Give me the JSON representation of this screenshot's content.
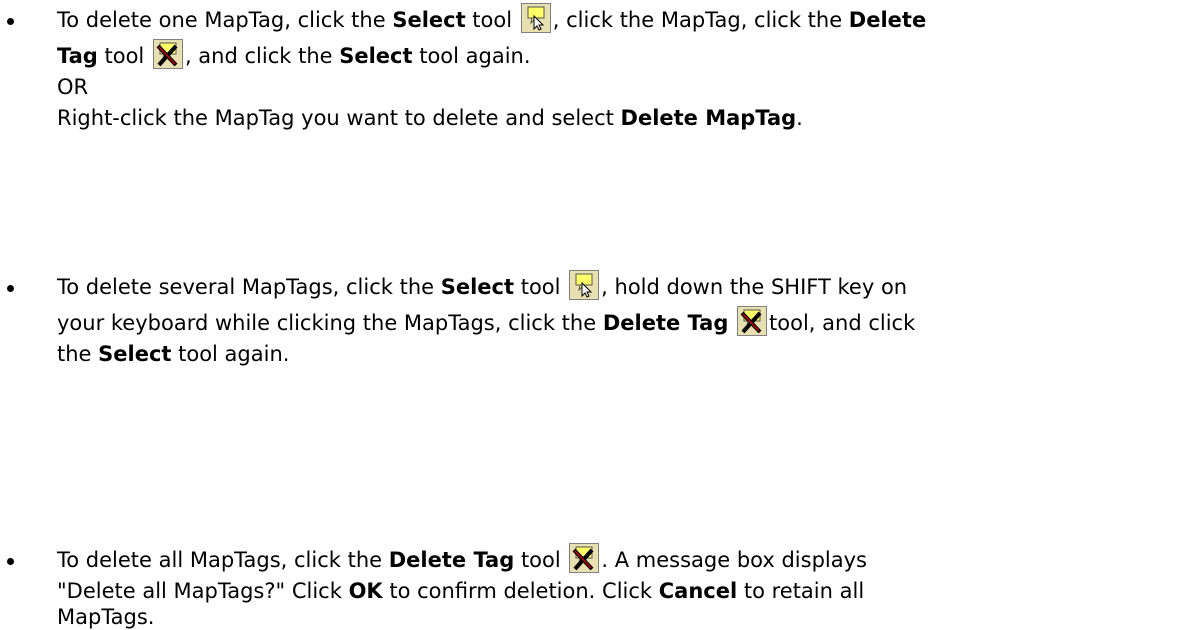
{
  "items": [
    {
      "lines": [
        [
          "To delete one MapTag, click the ",
          "Select",
          " tool ",
          "{select-icon}",
          ", click the MapTag, click the ",
          "Delete"
        ],
        [
          "Tag",
          " tool ",
          "{delete-icon}",
          ", and click the ",
          "Select",
          " tool again."
        ],
        [
          "OR"
        ],
        [
          "Right-click the MapTag you want to delete and select ",
          "Delete MapTag",
          "."
        ]
      ]
    },
    {
      "lines": [
        [
          "To delete several MapTags, click the ",
          "Select",
          " tool ",
          "{select-icon}",
          ", hold down the SHIFT key on"
        ],
        [
          "your keyboard while clicking the MapTags, click the ",
          "Delete Tag",
          " ",
          "{delete-icon}",
          "tool, and click"
        ],
        [
          "the ",
          "Select",
          " tool again."
        ]
      ]
    },
    {
      "lines": [
        [
          "To delete all MapTags, click the ",
          "Delete Tag",
          " tool ",
          "{delete-icon}",
          ". A message box displays"
        ],
        [
          "\"Delete all MapTags?\" Click ",
          "OK",
          " to confirm deletion. Click ",
          "Cancel",
          " to retain all"
        ],
        [
          "MapTags."
        ]
      ]
    }
  ],
  "text": {
    "i1l1a": "To delete one MapTag, click the ",
    "select": "Select",
    "tool_sp": " tool ",
    "i1l1b": ", click the MapTag, click the ",
    "delete": "Delete",
    "tag": "Tag",
    "i1l2a": ", and click the ",
    "tool_again": " tool again.",
    "or": "OR",
    "i1l4a": "Right-click the MapTag you want to delete and select ",
    "delete_maptag": "Delete MapTag",
    "period": ".",
    "i2l1a": "To delete several MapTags, click the ",
    "i2l1b": ", hold down the SHIFT key on",
    "i2l2a": "your keyboard while clicking the MapTags, click the ",
    "delete_tag": "Delete Tag",
    "i2l2b": "tool, and click",
    "the": "the ",
    "i3l1a": "To delete all MapTags, click the ",
    "i3l1b": ". A message box displays",
    "i3l2a": "\"Delete all MapTags?\" Click ",
    "ok": "OK",
    "i3l2b": " to confirm deletion. Click ",
    "cancel": "Cancel",
    "i3l2c": " to retain all",
    "maptags": "MapTags."
  },
  "icons": {
    "select": "select-tool-icon",
    "delete": "delete-tag-tool-icon"
  },
  "colors": {
    "icon_bg": "#e8e0b0",
    "tag_yellow": "#ffff66",
    "x_red": "#cc0000"
  }
}
